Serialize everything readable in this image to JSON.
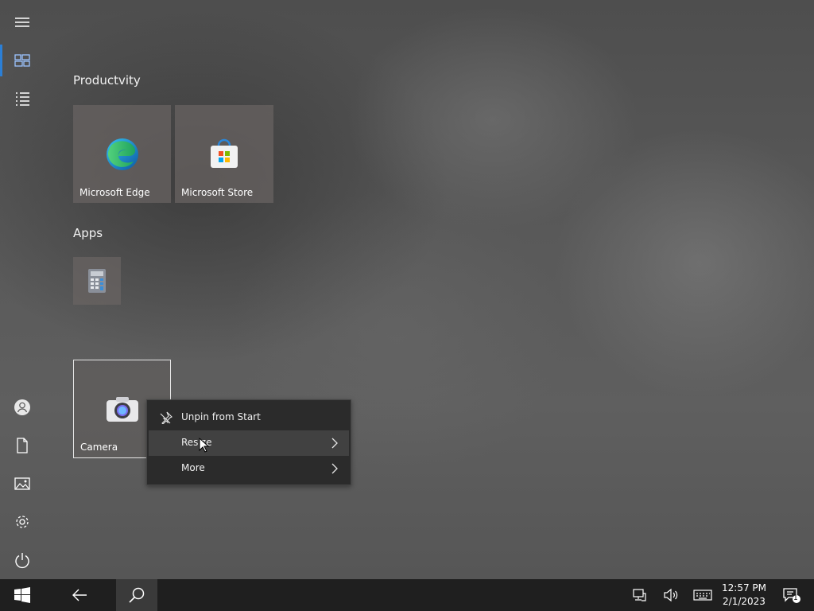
{
  "start": {
    "groups": [
      {
        "title": "Productvity"
      },
      {
        "title": "Apps"
      }
    ],
    "tiles": {
      "edge": {
        "label": "Microsoft Edge",
        "icon": "edge-icon"
      },
      "store": {
        "label": "Microsoft Store",
        "icon": "store-icon"
      },
      "calculator": {
        "icon": "calculator-icon"
      },
      "camera": {
        "label": "Camera",
        "icon": "camera-icon"
      }
    }
  },
  "rail": {
    "items": [
      {
        "name": "menu",
        "icon": "hamburger-icon"
      },
      {
        "name": "pinned-tiles",
        "icon": "tiles-icon",
        "active": true
      },
      {
        "name": "all-apps",
        "icon": "list-icon"
      },
      {
        "name": "user",
        "icon": "user-icon"
      },
      {
        "name": "documents",
        "icon": "document-icon"
      },
      {
        "name": "pictures",
        "icon": "pictures-icon"
      },
      {
        "name": "settings",
        "icon": "gear-icon"
      },
      {
        "name": "power",
        "icon": "power-icon"
      }
    ]
  },
  "context_menu": {
    "items": [
      {
        "label": "Unpin from Start",
        "icon": "unpin-icon"
      },
      {
        "label": "Resize",
        "submenu": true
      },
      {
        "label": "More",
        "submenu": true
      }
    ]
  },
  "taskbar": {
    "clock_time": "12:57 PM",
    "clock_date": "2/1/2023",
    "notification_count": "1"
  },
  "colors": {
    "accent": "#2b7fd6",
    "taskbar": "#1f1f1f",
    "menu_bg": "#2b2b2b"
  }
}
